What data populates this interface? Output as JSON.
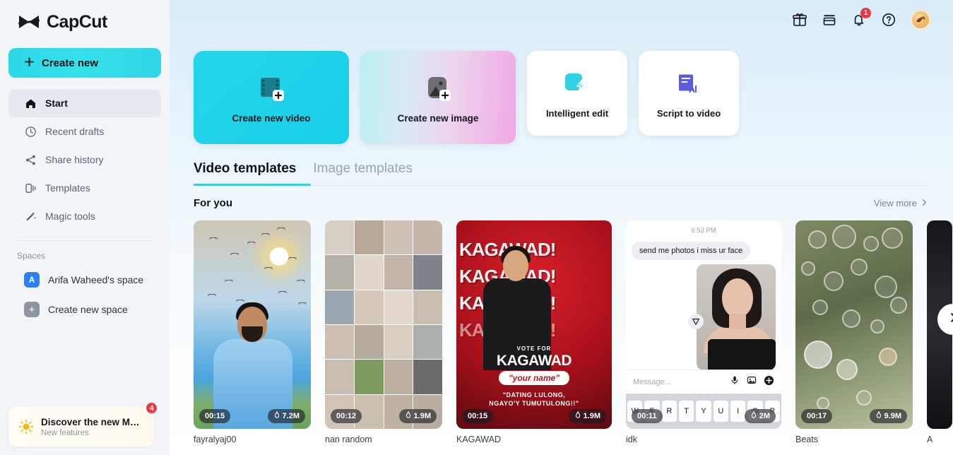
{
  "brand": {
    "name": "CapCut",
    "logo_icon": "capcut-logo-icon"
  },
  "sidebar": {
    "create_new": {
      "label": "Create new",
      "icon": "plus-icon"
    },
    "items": [
      {
        "label": "Start",
        "icon": "home-icon",
        "active": true
      },
      {
        "label": "Recent drafts",
        "icon": "clock-icon",
        "active": false
      },
      {
        "label": "Share history",
        "icon": "share-icon",
        "active": false
      },
      {
        "label": "Templates",
        "icon": "templates-icon",
        "active": false
      },
      {
        "label": "Magic tools",
        "icon": "magic-wand-icon",
        "active": false
      }
    ],
    "spaces_label": "Spaces",
    "spaces": [
      {
        "label": "Arifa Waheed's space",
        "badge": "A",
        "badge_color": "#2d7ff9"
      },
      {
        "label": "Create new space",
        "badge": "+",
        "badge_color": "#8b95a3"
      }
    ],
    "discover": {
      "title": "Discover the new M…",
      "subtitle": "New features",
      "badge": "4",
      "icon": "sun-sparkle-icon"
    }
  },
  "topbar": {
    "icons": [
      {
        "name": "gift-icon"
      },
      {
        "name": "archive-box-icon"
      },
      {
        "name": "bell-icon",
        "badge": "1"
      },
      {
        "name": "help-circle-icon"
      }
    ],
    "avatar": {
      "name": "avatar",
      "alt": "user-avatar"
    }
  },
  "action_cards": [
    {
      "label": "Create new video",
      "icon": "film-plus-icon",
      "style": "c-video",
      "size": "big"
    },
    {
      "label": "Create new image",
      "icon": "image-plus-icon",
      "style": "c-image",
      "size": "big"
    },
    {
      "label": "Intelligent edit",
      "icon": "magic-clip-icon",
      "style": "c-white",
      "size": "small"
    },
    {
      "label": "Script to video",
      "icon": "script-ai-icon",
      "style": "c-white",
      "size": "small"
    }
  ],
  "tabs": [
    {
      "label": "Video templates",
      "active": true
    },
    {
      "label": "Image templates",
      "active": false
    }
  ],
  "section": {
    "title": "For you",
    "view_more": "View more",
    "view_more_icon": "chevron-right-icon",
    "next_icon": "chevron-right-icon"
  },
  "templates": [
    {
      "title": "fayralyaj00",
      "duration": "00:15",
      "plays": "7.2M",
      "plays_icon": "fire-icon",
      "art": "sunset-man"
    },
    {
      "title": "nan random",
      "duration": "00:12",
      "plays": "1.9M",
      "plays_icon": "fire-icon",
      "art": "collage"
    },
    {
      "title": "KAGAWAD",
      "duration": "00:15",
      "plays": "1.9M",
      "plays_icon": "fire-icon",
      "art": "kagawad"
    },
    {
      "title": "idk",
      "duration": "00:11",
      "plays": "2M",
      "plays_icon": "fire-icon",
      "art": "chat"
    },
    {
      "title": "Beats",
      "duration": "00:17",
      "plays": "9.9M",
      "plays_icon": "fire-icon",
      "art": "beats"
    }
  ],
  "chat_thumb": {
    "time": "6:53 PM",
    "message": "send me photos i miss ur face",
    "input_placeholder": "Message...",
    "keys": [
      "W",
      "E",
      "R",
      "T",
      "Y",
      "U",
      "I",
      "O",
      "P"
    ],
    "icons": [
      "mic-icon",
      "photo-icon",
      "plus-circle-icon",
      "send-icon"
    ]
  },
  "colors": {
    "accent": "#2fd6e6",
    "tab_underline": "#3ccfdb",
    "badge_red": "#f5333f",
    "space_blue": "#2d7ff9",
    "sidebar_bg": "#f3f6f9"
  }
}
